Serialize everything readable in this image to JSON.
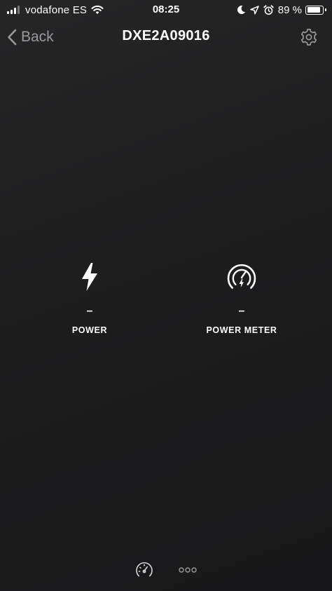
{
  "status_bar": {
    "carrier": "vodafone ES",
    "time": "08:25",
    "battery_percent": "89 %",
    "battery_level": 0.89,
    "icons": [
      "signal-icon",
      "wifi-icon",
      "moon-icon",
      "location-icon",
      "alarm-icon",
      "battery-icon"
    ]
  },
  "nav": {
    "back_label": "Back",
    "title": "DXE2A09016",
    "back_icon": "chevron-left-icon",
    "settings_icon": "gear-icon"
  },
  "tiles": [
    {
      "icon": "lightning-bolt-icon",
      "value": "–",
      "label": "POWER"
    },
    {
      "icon": "power-meter-gauge-icon",
      "value": "–",
      "label": "POWER METER"
    }
  ],
  "tab_bar": {
    "icons": [
      "gauge-icon",
      "more-dots-icon"
    ]
  },
  "colors": {
    "background": "#1f1f20",
    "text": "#ffffff",
    "muted": "#9a9a9c"
  }
}
